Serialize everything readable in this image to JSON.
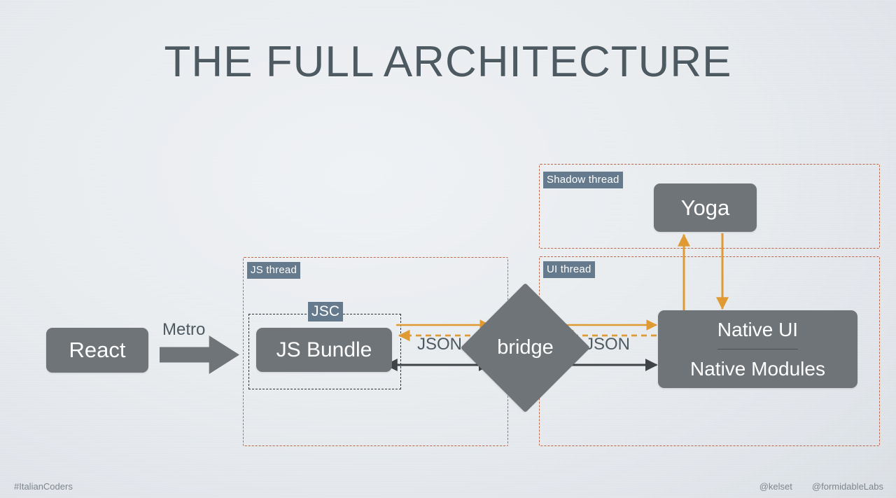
{
  "slide": {
    "title": "THE FULL ARCHITECTURE",
    "background_color": "#e6eaee",
    "title_color": "#4e5a62"
  },
  "palette": {
    "node_gray": "#6e7478",
    "tag_blue_gray": "#667a8e",
    "region_dashed_orange": "#bf6845",
    "jsc_dashed_dark": "#2c3136",
    "arrow_orange": "#e09a34",
    "arrow_dark": "#3d4347"
  },
  "nodes": {
    "react": {
      "label": "React"
    },
    "js_bundle": {
      "label": "JS Bundle"
    },
    "bridge": {
      "label": "bridge"
    },
    "yoga": {
      "label": "Yoga"
    },
    "native": {
      "top_label": "Native UI",
      "bottom_label": "Native Modules"
    }
  },
  "regions": {
    "js_thread": {
      "tag": "JS thread"
    },
    "jsc": {
      "tag": "JSC"
    },
    "shadow_thread": {
      "tag": "Shadow thread"
    },
    "ui_thread": {
      "tag": "UI thread"
    }
  },
  "edges": {
    "metro": {
      "label": "Metro"
    },
    "json_left": {
      "label": "JSON"
    },
    "json_right": {
      "label": "JSON"
    }
  },
  "footer": {
    "left": "#ItalianCoders",
    "handle_author": "@kelset",
    "handle_org": "@formidableLabs"
  }
}
